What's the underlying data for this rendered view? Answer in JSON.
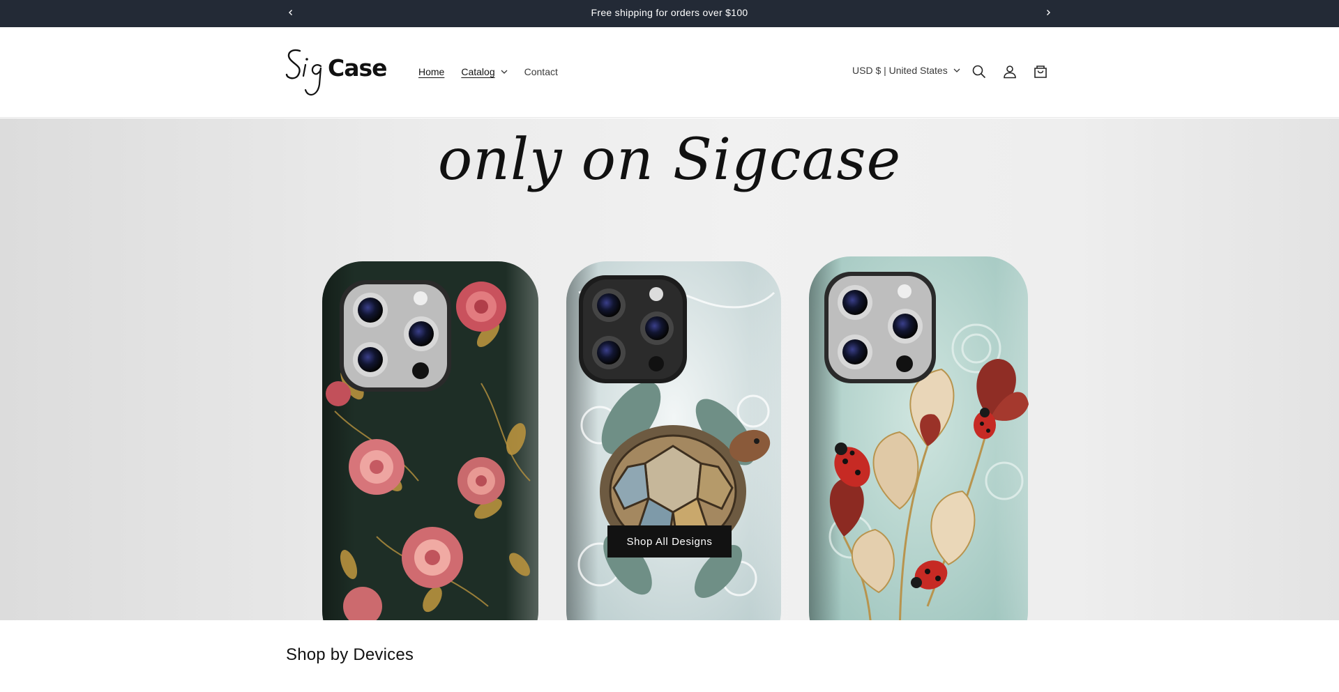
{
  "announcement": {
    "message": "Free shipping for orders over $100"
  },
  "header": {
    "logo_text": "SigCase",
    "nav": [
      {
        "label": "Home"
      },
      {
        "label": "Catalog"
      },
      {
        "label": "Contact"
      }
    ],
    "country_selector": "USD $ | United States"
  },
  "hero": {
    "headline": "only on Sigcase",
    "cta_label": "Shop All Designs"
  },
  "section": {
    "title": "Shop by Devices"
  },
  "icons": [
    "chevron-left-icon",
    "chevron-right-icon",
    "chevron-down-icon",
    "search-icon",
    "account-icon",
    "cart-icon"
  ],
  "colors": {
    "announcement_bg": "#232a36",
    "cta_bg": "#121212",
    "text": "#121212"
  }
}
